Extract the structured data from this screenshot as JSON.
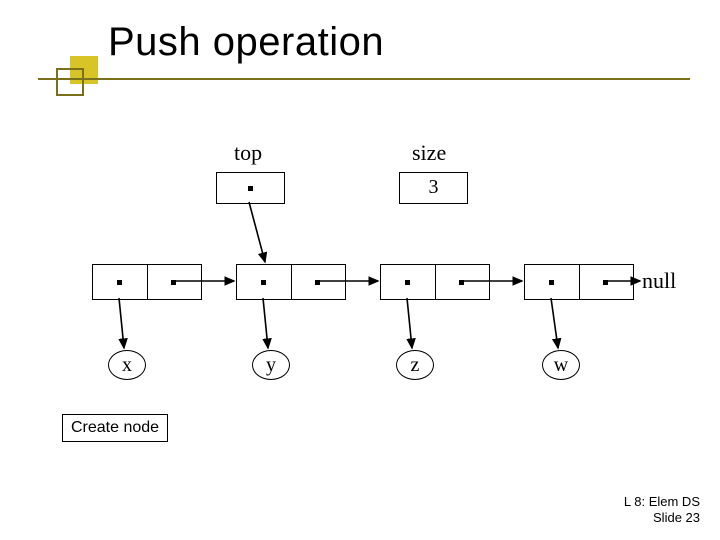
{
  "title": "Push operation",
  "header": {
    "top_label": "top",
    "size_label": "size",
    "size_value": "3"
  },
  "nodes": {
    "n1": "x",
    "n2": "y",
    "n3": "z",
    "n4": "w"
  },
  "null_label": "null",
  "step_label": "Create node",
  "footer": {
    "line1": "L 8: Elem DS",
    "line2": "Slide 23"
  }
}
